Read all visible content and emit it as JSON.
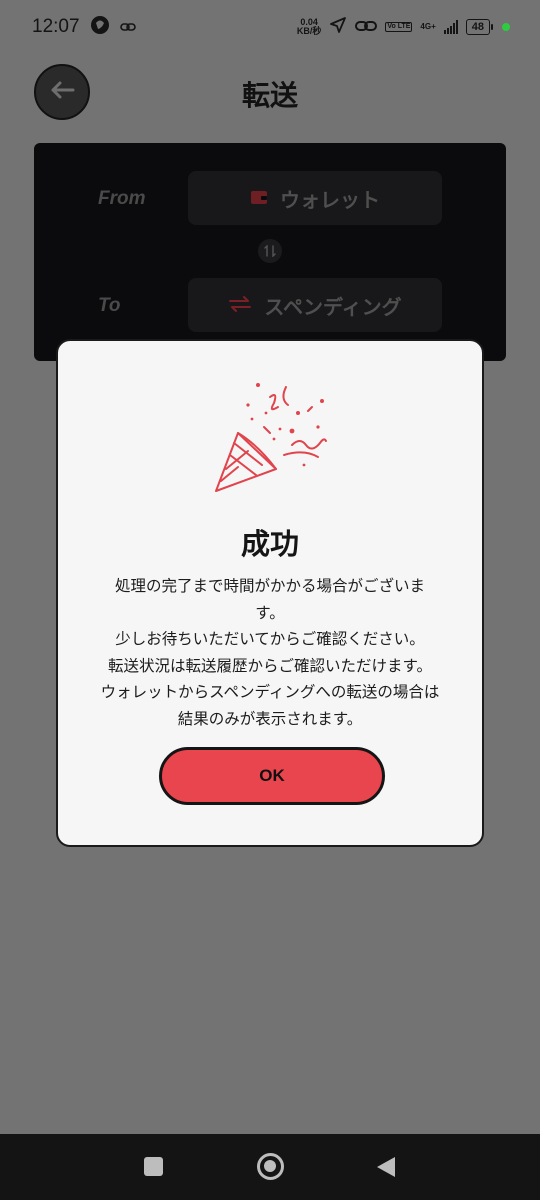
{
  "status_bar": {
    "time": "12:07",
    "net_speed_value": "0.04",
    "net_speed_unit": "KB/秒",
    "volte": "Vo LTE",
    "network": "4G+",
    "battery": "48"
  },
  "header": {
    "title": "転送"
  },
  "transfer": {
    "from_label": "From",
    "from_value": "ウォレット",
    "to_label": "To",
    "to_value": "スペンディング"
  },
  "modal": {
    "title": "成功",
    "body_lines": [
      "処理の完了まで時間がかかる場合がございま",
      "す。",
      "少しお待ちいただいてからご確認ください。",
      "転送状況は転送履歴からご確認いただけます。",
      "ウォレットからスペンディングへの転送の場合は",
      "結果のみが表示されます。"
    ],
    "ok_label": "OK"
  },
  "colors": {
    "accent": "#e8454e",
    "overlay": "#737373",
    "card_bg": "#0b0b0d",
    "modal_bg": "#f6f6f6"
  },
  "icons": {
    "back": "arrow-left-icon",
    "wallet": "wallet-icon",
    "swap": "swap-vertical-icon",
    "transfer": "transfer-arrows-icon",
    "celebration": "party-popper-icon"
  }
}
